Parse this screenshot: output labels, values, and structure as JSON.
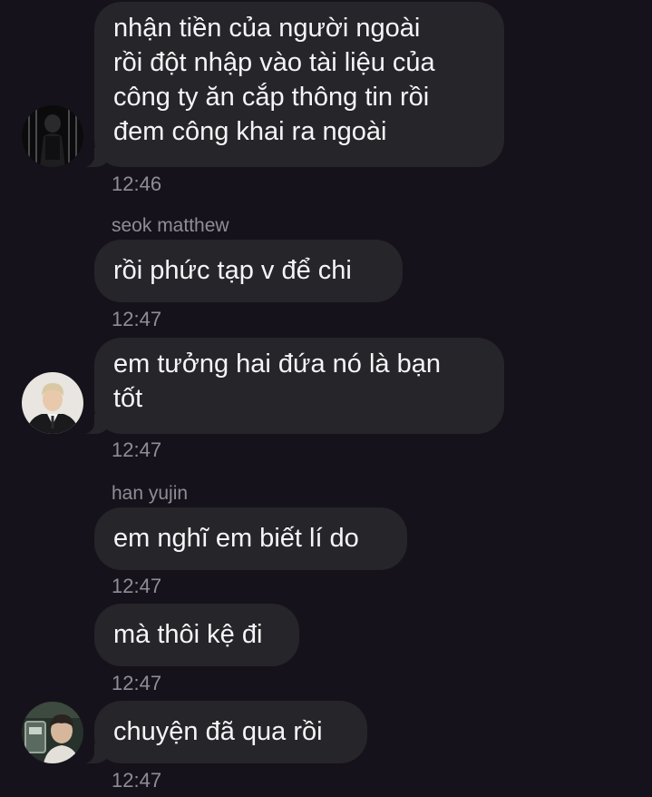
{
  "messages": [
    {
      "text": "nhận tiền của người ngoài\nrồi đột nhập vào tài liệu của\ncông ty ăn cắp thông tin rồi\nđem công khai ra ngoài",
      "time": "12:46"
    },
    {
      "sender": "seok matthew",
      "text": "rồi phức tạp v để chi",
      "time": "12:47"
    },
    {
      "text": "em tưởng hai đứa nó là bạn\ntốt",
      "time": "12:47"
    },
    {
      "sender": "han yujin",
      "text": "em nghĩ em biết lí do",
      "time": "12:47"
    },
    {
      "text": "mà thôi kệ đi",
      "time": "12:47"
    },
    {
      "text": "chuyện đã qua rồi",
      "time": "12:47"
    }
  ],
  "colors": {
    "background": "#16121b",
    "bubble": "#262529",
    "text": "#f5f5f7",
    "meta": "#8e8e95"
  },
  "avatars": [
    "dark-figure-avatar",
    "blond-man-in-suit-avatar",
    "man-with-mirror-avatar"
  ]
}
